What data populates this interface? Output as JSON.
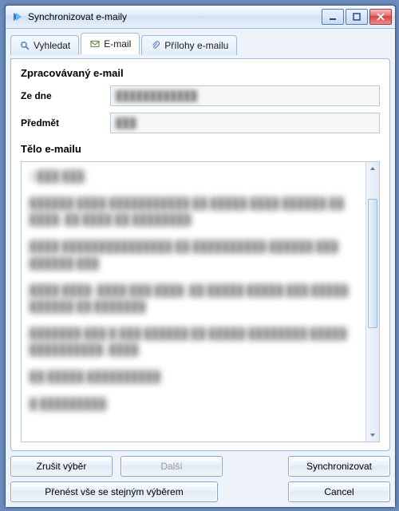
{
  "window": {
    "title": "Synchronizovat e-maily"
  },
  "tabs": {
    "search": "Vyhledat",
    "email": "E-mail",
    "attachments": "Přílohy e-mailu"
  },
  "section": {
    "processed": "Zpracovávaný e-mail",
    "date_label": "Ze dne",
    "subject_label": "Předmět",
    "body_label": "Tělo e-mailu",
    "date_value": "████████████",
    "subject_value": "███"
  },
  "body": {
    "p1": "D███ ███,",
    "p2": "██████ ████ ███████████ ██ █████ ████ ██████ ██ ████, ██ ████ ██ ████████",
    "p3": "████ ███████████████ ██ ██████████ ██████ ███ ██████ ███",
    "p4": "████ ████. ████ ███ ████, ██ █████ █████ ███ █████ ██████ ██ ███████",
    "p5": "███████ ███ █ ███ ██████ ██ █████ ████████ █████ ██████████, ████",
    "p6": "██ █████ ██████████",
    "p7": "█ █████████,"
  },
  "buttons": {
    "cancel_select": "Zrušit výběr",
    "next": "Další",
    "sync": "Synchronizovat",
    "apply_all": "Přenést vše se stejným výběrem",
    "cancel": "Cancel"
  }
}
